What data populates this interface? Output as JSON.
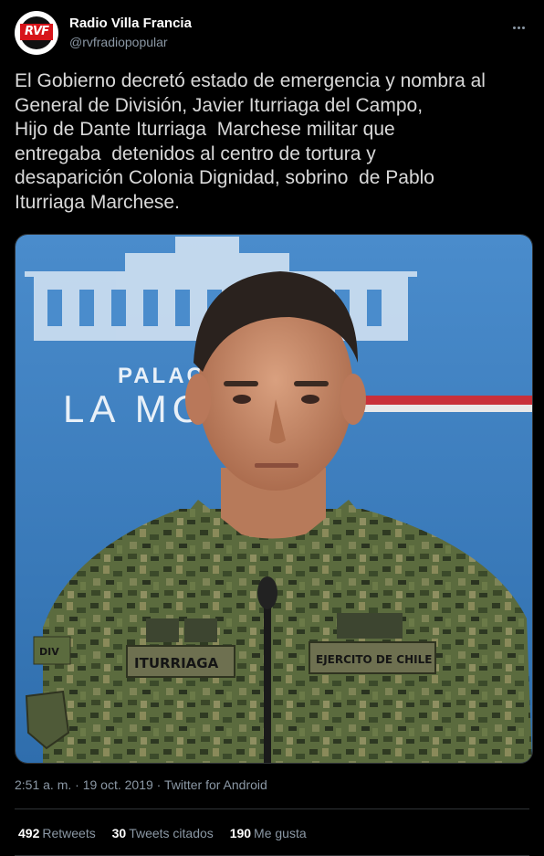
{
  "author": {
    "name": "Radio Villa Francia",
    "handle": "@rvfradiopopular",
    "avatar_text": "RVF"
  },
  "tweet": {
    "text": "El Gobierno decretó estado de emergencia y nombra al\nGeneral de División, Javier Iturriaga del Campo,\nHijo de Dante Iturriaga  Marchese militar que\nentregaba  detenidos al centro de tortura y\ndesaparición Colonia Dignidad, sobrino  de Pablo\nIturriaga Marchese."
  },
  "media": {
    "backdrop_line1": "PALAC",
    "backdrop_line2": "LA MO",
    "name_tape": "ITURRIAGA",
    "branch_tape": "EJERCITO DE CHILE",
    "sleeve_patch": "DIV"
  },
  "meta": {
    "time": "2:51 a. m.",
    "separator1": " · ",
    "date": "19 oct. 2019",
    "separator2": " · ",
    "source": "Twitter for Android"
  },
  "stats": {
    "retweets_count": "492",
    "retweets_label": "Retweets",
    "quotes_count": "30",
    "quotes_label": "Tweets citados",
    "likes_count": "190",
    "likes_label": "Me gusta"
  },
  "colors": {
    "background": "#000000",
    "text": "#d9d9d9",
    "secondary": "#8b98a5",
    "divider": "#2f3336",
    "backdrop_blue": "#3e7fc0"
  }
}
